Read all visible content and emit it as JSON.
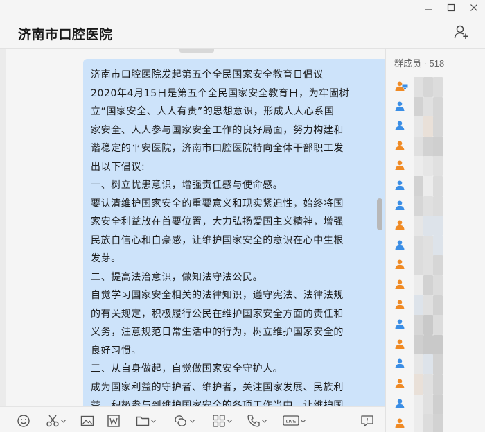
{
  "window": {
    "title": "济南市口腔医院"
  },
  "message": {
    "lines": [
      "济南市口腔医院发起第五个全民国家安全教育日倡议",
      "2020年4月15日是第五个全民国家安全教育日，为牢固树",
      "立“国家安全、人人有责”的思想意识，形成人人心系国",
      "家安全、人人参与国家安全工作的良好局面，努力构建和",
      "谐稳定的平安医院，济南市口腔医院特向全体干部职工发",
      "出以下倡议:",
      "一、树立忧患意识，增强责任感与使命感。",
      "要认清维护国家安全的重要意义和现实紧迫性，始终将国",
      "家安全利益放在首要位置，大力弘扬爱国主义精神，增强",
      "民族自信心和自豪感，让维护国家安全的意识在心中生根",
      "发芽。",
      "二、提高法治意识，做知法守法公民。",
      "自觉学习国家安全相关的法律知识，遵守宪法、法律法规",
      "的有关规定，积极履行公民在维护国家安全方面的责任和",
      "义务，注意规范日常生活中的行为，树立维护国家安全的",
      "良好习惯。",
      "三、从自身做起，自觉做国家安全守护人。",
      "成为国家利益的守护者、维护者，关注国家发展、民族利",
      "益，积极参与到维护国家安全的各项工作当中，让维护国"
    ]
  },
  "members": {
    "header": "群成员 · 518",
    "icon_colors": [
      "orange",
      "blue",
      "blue",
      "orange",
      "orange",
      "blue",
      "blue",
      "orange",
      "blue",
      "orange",
      "orange",
      "orange",
      "blue",
      "orange",
      "blue",
      "orange",
      "blue",
      "orange"
    ]
  },
  "toolbar": {
    "items": [
      "emoji-icon",
      "scissors-icon",
      "image-icon",
      "word-doc-icon",
      "folder-icon",
      "sticker-icon",
      "apps-icon",
      "phone-icon",
      "live-icon",
      "feedback-icon"
    ],
    "live_label": "LIVE"
  },
  "colors": {
    "bubble": "#cde3fa",
    "member_blue": "#3a8ee6",
    "member_orange": "#f08a24"
  }
}
